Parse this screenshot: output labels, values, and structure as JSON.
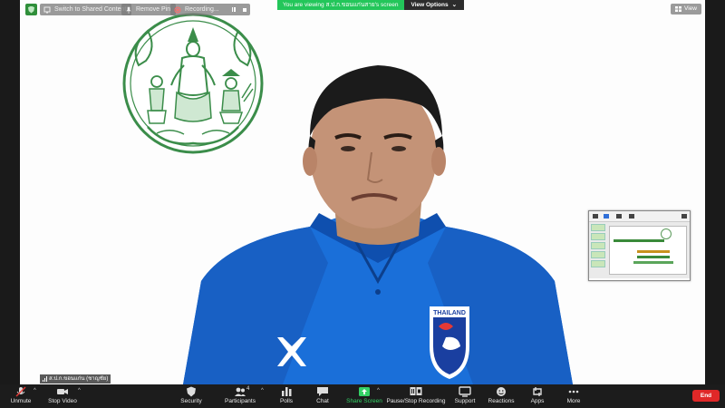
{
  "top_bar": {
    "switch_label": "Switch to Shared Content",
    "remove_pin_label": "Remove Pin",
    "recording_label": "Recording...",
    "viewing_text": "You are viewing ส.ป.ก.ขอนแก่นสาย's screen",
    "view_options_label": "View Options",
    "view_label": "View"
  },
  "name_tag": {
    "name": "ส.ป.ก.ขอนแก่น (ชาญชัย)"
  },
  "jersey_text": "THAILAND",
  "toolbar": {
    "unmute": "Unmute",
    "stop_video": "Stop Video",
    "security": "Security",
    "participants": "Participants",
    "participants_count": "4",
    "polls": "Polls",
    "chat": "Chat",
    "share_screen": "Share Screen",
    "pause_stop_recording": "Pause/Stop Recording",
    "support": "Support",
    "reactions": "Reactions",
    "apps": "Apps",
    "more": "More",
    "end": "End"
  },
  "colors": {
    "share_green": "#23c65a",
    "end_red": "#e02828",
    "toolbar_bg": "#1c1c1c",
    "jersey_blue": "#1a6fd9",
    "seal_green": "#3b8d4a"
  }
}
